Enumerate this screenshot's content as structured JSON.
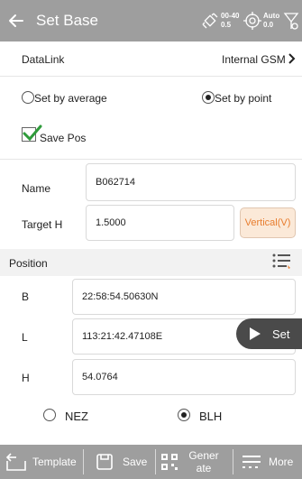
{
  "header": {
    "title": "Set Base",
    "status": [
      {
        "icon": "satellite-icon",
        "top": "00-40",
        "bottom": "0.5"
      },
      {
        "icon": "target-icon",
        "top": "Auto",
        "bottom": "0.0"
      },
      {
        "icon": "antenna-icon"
      }
    ]
  },
  "datalink": {
    "label": "DataLink",
    "value": "Internal GSM"
  },
  "mode": {
    "average_label": "Set by average",
    "point_label": "Set by point",
    "selected": "point"
  },
  "save_pos": {
    "label": "Save Pos",
    "checked": true
  },
  "name": {
    "label": "Name",
    "value": "B062714"
  },
  "target_h": {
    "label": "Target H",
    "value": "1.5000",
    "button": "Vertical(V)"
  },
  "position": {
    "label": "Position"
  },
  "coords": {
    "b": {
      "label": "B",
      "value": "22:58:54.50630N"
    },
    "l": {
      "label": "L",
      "value": "113:21:42.47108E"
    },
    "h": {
      "label": "H",
      "value": "54.0764"
    }
  },
  "set_button": "Set",
  "coord_type": {
    "nez": "NEZ",
    "blh": "BLH",
    "selected": "BLH"
  },
  "bottom": {
    "template": "Template",
    "save": "Save",
    "generate": "Generate",
    "more": "More"
  },
  "colors": {
    "bar": "#9e9e9e",
    "accent": "#e87d2e",
    "check": "#2e9b3a"
  }
}
